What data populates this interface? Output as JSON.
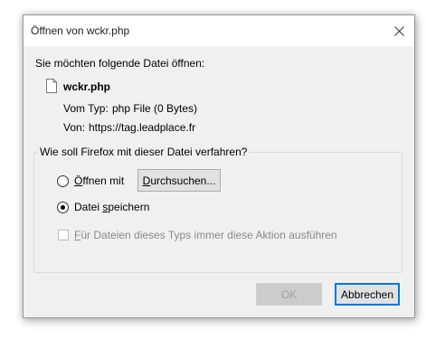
{
  "window": {
    "title": "Öffnen von wckr.php"
  },
  "intro": {
    "prompt": "Sie möchten folgende Datei öffnen:",
    "filename": "wckr.php",
    "type_label": "Vom Typ:",
    "type_value": "php File (0 Bytes)",
    "from_label": "Von:",
    "from_value": "https://tag.leadplace.fr"
  },
  "action_group": {
    "title": "Wie soll Firefox mit dieser Datei verfahren?",
    "open_with": {
      "label_accel": "Ö",
      "label_rest": "ffnen mit",
      "selected": false
    },
    "browse_button": {
      "label_accel": "D",
      "label_rest": "urchsuchen..."
    },
    "save_file": {
      "label_pre": "Datei ",
      "label_accel": "s",
      "label_rest": "peichern",
      "selected": true
    },
    "always_checkbox": {
      "label_accel": "F",
      "label_rest": "ür Dateien dieses Typs immer diese Aktion ausführen",
      "checked": false,
      "enabled": false
    }
  },
  "buttons": {
    "ok": "OK",
    "cancel": "Abbrechen"
  }
}
